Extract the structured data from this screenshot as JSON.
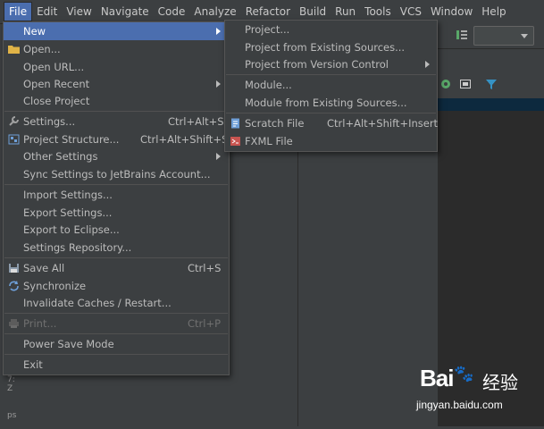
{
  "menubar": {
    "items": [
      {
        "label": "File",
        "active": true
      },
      {
        "label": "Edit"
      },
      {
        "label": "View"
      },
      {
        "label": "Navigate"
      },
      {
        "label": "Code"
      },
      {
        "label": "Analyze"
      },
      {
        "label": "Refactor"
      },
      {
        "label": "Build"
      },
      {
        "label": "Run"
      },
      {
        "label": "Tools"
      },
      {
        "label": "VCS"
      },
      {
        "label": "Window"
      },
      {
        "label": "Help"
      }
    ]
  },
  "file_menu": {
    "items": [
      {
        "label": "New",
        "submenu": true,
        "selected": true,
        "icon": ""
      },
      {
        "label": "Open...",
        "icon": "folder-icon"
      },
      {
        "label": "Open URL..."
      },
      {
        "label": "Open Recent",
        "submenu": true
      },
      {
        "label": "Close Project"
      },
      {
        "label": "Settings...",
        "shortcut": "Ctrl+Alt+S",
        "icon": "wrench-icon"
      },
      {
        "label": "Project Structure...",
        "shortcut": "Ctrl+Alt+Shift+S",
        "icon": "project-structure-icon"
      },
      {
        "label": "Other Settings",
        "submenu": true
      },
      {
        "label": "Sync Settings to JetBrains Account..."
      },
      {
        "label": "Import Settings..."
      },
      {
        "label": "Export Settings..."
      },
      {
        "label": "Export to Eclipse..."
      },
      {
        "label": "Settings Repository..."
      },
      {
        "label": "Save All",
        "shortcut": "Ctrl+S",
        "icon": "save-icon"
      },
      {
        "label": "Synchronize",
        "icon": "sync-icon"
      },
      {
        "label": "Invalidate Caches / Restart..."
      },
      {
        "label": "Print...",
        "shortcut": "Ctrl+P",
        "disabled": true,
        "icon": "print-icon"
      },
      {
        "label": "Power Save Mode"
      },
      {
        "label": "Exit"
      }
    ]
  },
  "new_submenu": {
    "items": [
      {
        "label": "Project..."
      },
      {
        "label": "Project from Existing Sources..."
      },
      {
        "label": "Project from Version Control",
        "submenu": true
      },
      {
        "label": "Module..."
      },
      {
        "label": "Module from Existing Sources..."
      },
      {
        "label": "Scratch File",
        "shortcut": "Ctrl+Alt+Shift+Insert",
        "icon": "scratch-file-icon"
      },
      {
        "label": "FXML File",
        "icon": "fxml-file-icon"
      }
    ]
  },
  "side_tabs": [
    "7: Z",
    "ps"
  ],
  "watermark": {
    "logo": "Bai",
    "logo_suffix": "经验",
    "url": "jingyan.baidu.com"
  },
  "colors": {
    "selection": "#4b6eaf",
    "background": "#3c3f41",
    "editor": "#2b2b2b"
  }
}
